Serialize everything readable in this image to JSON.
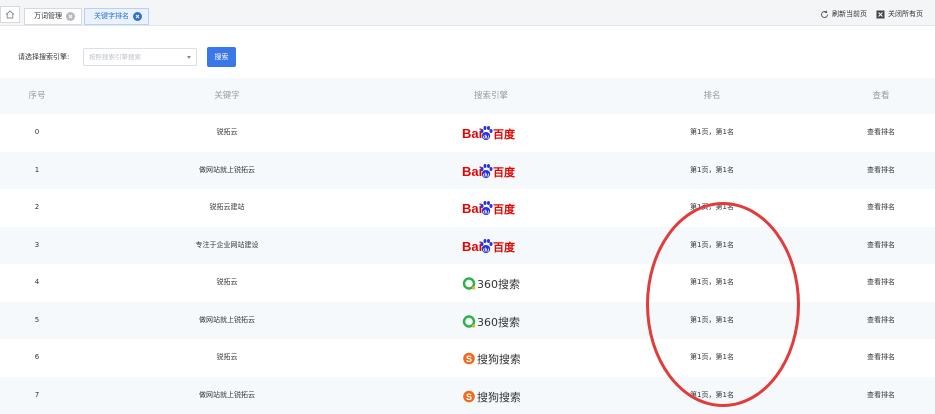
{
  "tabbar": {
    "tabs": [
      {
        "label": "万词管理",
        "active": false
      },
      {
        "label": "关键字排名",
        "active": true
      }
    ],
    "refresh_label": "刷新当前页",
    "close_all_label": "关闭所有页"
  },
  "filter": {
    "label": "请选择搜索引擎:",
    "placeholder": "按照搜索引擎搜索",
    "button_label": "搜索"
  },
  "table": {
    "columns": [
      "序号",
      "关键字",
      "搜索引擎",
      "排名",
      "查看"
    ],
    "rows": [
      {
        "index": "0",
        "keyword": "锐拓云",
        "engine": "baidu",
        "rank": "第1页，第1名",
        "action": "查看排名"
      },
      {
        "index": "1",
        "keyword": "做网站就上锐拓云",
        "engine": "baidu",
        "rank": "第1页，第1名",
        "action": "查看排名"
      },
      {
        "index": "2",
        "keyword": "锐拓云建站",
        "engine": "baidu",
        "rank": "第1页，第1名",
        "action": "查看排名"
      },
      {
        "index": "3",
        "keyword": "专注于企业网站建设",
        "engine": "baidu",
        "rank": "第1页，第1名",
        "action": "查看排名"
      },
      {
        "index": "4",
        "keyword": "锐拓云",
        "engine": "360",
        "rank": "第1页，第1名",
        "action": "查看排名"
      },
      {
        "index": "5",
        "keyword": "做网站就上锐拓云",
        "engine": "360",
        "rank": "第1页，第1名",
        "action": "查看排名"
      },
      {
        "index": "6",
        "keyword": "锐拓云",
        "engine": "sogou",
        "rank": "第1页，第1名",
        "action": "查看排名"
      },
      {
        "index": "7",
        "keyword": "做网站就上锐拓云",
        "engine": "sogou",
        "rank": "第1页，第1名",
        "action": "查看排名"
      }
    ]
  },
  "engines": {
    "baidu": {
      "text_left": "Bai",
      "text_right": "百度",
      "color": "#e10601",
      "paw_color": "#2932e1"
    },
    "360": {
      "text": "360搜索",
      "color": "#333333",
      "ring_color": "#28b34b",
      "accent": "#f5a623"
    },
    "sogou": {
      "text": "搜狗搜索",
      "color": "#333333",
      "icon_color": "#f26b1d"
    }
  },
  "colors": {
    "accent": "#3b78e7",
    "annotation": "#e23b3b",
    "header_text": "#999999",
    "stripe": "#f6f9fc"
  }
}
